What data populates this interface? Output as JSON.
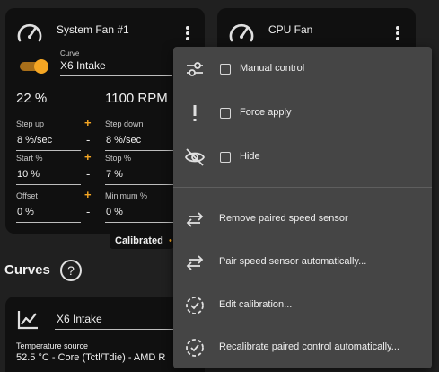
{
  "fan_card_1": {
    "name": "System Fan #1",
    "curve_label": "Curve",
    "curve_value": "X6 Intake",
    "percent": "22 %",
    "rpm": "1100 RPM",
    "step_up_label": "Step up",
    "step_up_value": "8 %/sec",
    "step_down_label": "Step down",
    "step_down_value": "8 %/sec",
    "start_label": "Start %",
    "start_value": "10 %",
    "stop_label": "Stop %",
    "stop_value": "7 %",
    "offset_label": "Offset",
    "offset_value": "0 %",
    "minimum_label": "Minimum %",
    "minimum_value": "0 %",
    "calibrated": "Calibrated",
    "toggle_on": true,
    "accent_color": "#f5a623"
  },
  "fan_card_2": {
    "name": "CPU Fan"
  },
  "curves_section": {
    "heading": "Curves",
    "help_icon": "?",
    "curve_card": {
      "name": "X6 Intake",
      "source_label": "Temperature source",
      "source_value": "52.5 °C - Core (Tctl/Tdie) - AMD R"
    }
  },
  "context_menu": {
    "items": [
      {
        "label": "Manual control",
        "icon": "sliders-icon",
        "checkbox": true,
        "checked": false
      },
      {
        "label": "Force apply",
        "icon": "exclamation-icon",
        "checkbox": true,
        "checked": false
      },
      {
        "label": "Hide",
        "icon": "eye-off-icon",
        "checkbox": true,
        "checked": false
      },
      {
        "label": "Remove paired speed sensor",
        "icon": "swap-arrows-icon"
      },
      {
        "label": "Pair speed sensor automatically...",
        "icon": "swap-arrows-icon"
      },
      {
        "label": "Edit calibration...",
        "icon": "dashed-check-circle-icon"
      },
      {
        "label": "Recalibrate paired control automatically...",
        "icon": "dashed-check-circle-icon"
      }
    ]
  }
}
